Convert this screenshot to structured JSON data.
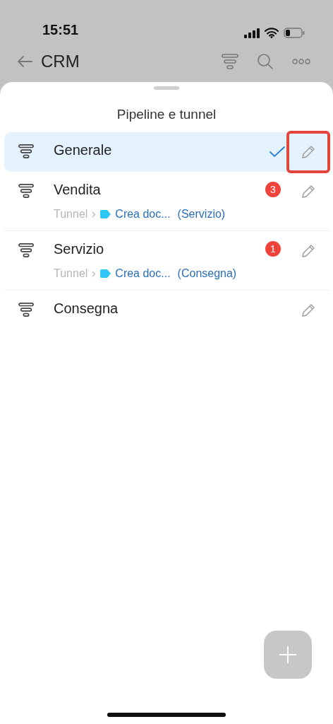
{
  "status_bar": {
    "time": "15:51"
  },
  "nav": {
    "title": "CRM"
  },
  "sheet": {
    "title": "Pipeline e tunnel"
  },
  "pipelines": [
    {
      "name": "Generale",
      "selected": true,
      "highlighted": true
    },
    {
      "name": "Vendita",
      "selected": false,
      "highlighted": false,
      "badge": "3",
      "tunnel": {
        "label": "Tunnel",
        "stage": "Crea doc...",
        "target": "(Servizio)",
        "color": "#2fc6f6"
      }
    },
    {
      "name": "Servizio",
      "selected": false,
      "highlighted": false,
      "badge": "1",
      "tunnel": {
        "label": "Tunnel",
        "stage": "Crea doc...",
        "target": "(Consegna)",
        "color": "#2fc6f6"
      }
    },
    {
      "name": "Consegna",
      "selected": false,
      "highlighted": false
    }
  ]
}
